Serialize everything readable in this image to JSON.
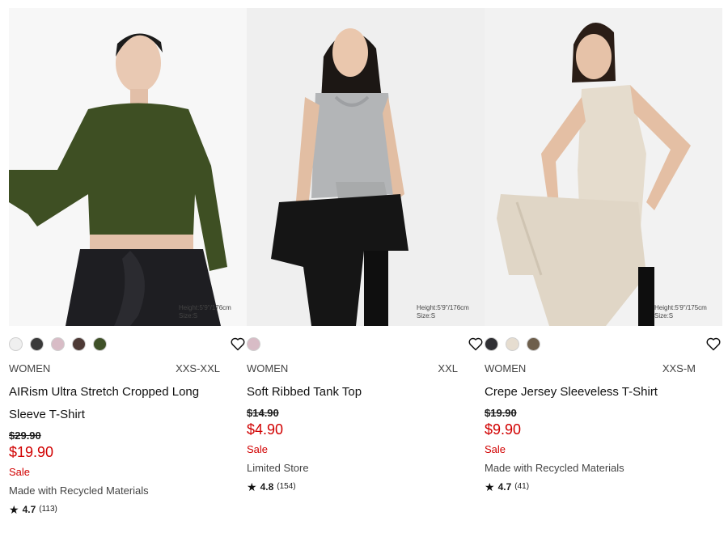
{
  "products": [
    {
      "model_note": [
        "Height:5'9\"/176cm",
        "Size:S"
      ],
      "swatches": [
        "#efefef",
        "#3a3a3a",
        "#d8bcc6",
        "#4e3a36",
        "#3f5128"
      ],
      "gender": "WOMEN",
      "sizes": "XXS-XXL",
      "name": "AIRism Ultra Stretch Cropped Long Sleeve T-Shirt",
      "old_price": "$29.90",
      "price": "$19.90",
      "flag": "Sale",
      "attribute": "Made with Recycled Materials",
      "rating": "4.7",
      "reviews": "(113)"
    },
    {
      "model_note": [
        "Height:5'9\"/176cm",
        "Size:S"
      ],
      "swatches": [
        "#d8bcc6"
      ],
      "gender": "WOMEN",
      "sizes": "XXL",
      "name": "Soft Ribbed Tank Top",
      "old_price": "$14.90",
      "price": "$4.90",
      "flag": "Sale",
      "attribute": "Limited Store",
      "rating": "4.8",
      "reviews": "(154)"
    },
    {
      "model_note": [
        "Height:5'9\"/175cm",
        "Size:S"
      ],
      "swatches": [
        "#2f2f33",
        "#e6ddd0",
        "#6e5f4c"
      ],
      "gender": "WOMEN",
      "sizes": "XXS-M",
      "name": "Crepe Jersey Sleeveless T-Shirt",
      "old_price": "$19.90",
      "price": "$9.90",
      "flag": "Sale",
      "attribute": "Made with Recycled Materials",
      "rating": "4.7",
      "reviews": "(41)"
    }
  ],
  "icons": {
    "favorite": "heart-icon",
    "rating": "star-icon"
  },
  "colors": {
    "sale": "#d10000"
  }
}
